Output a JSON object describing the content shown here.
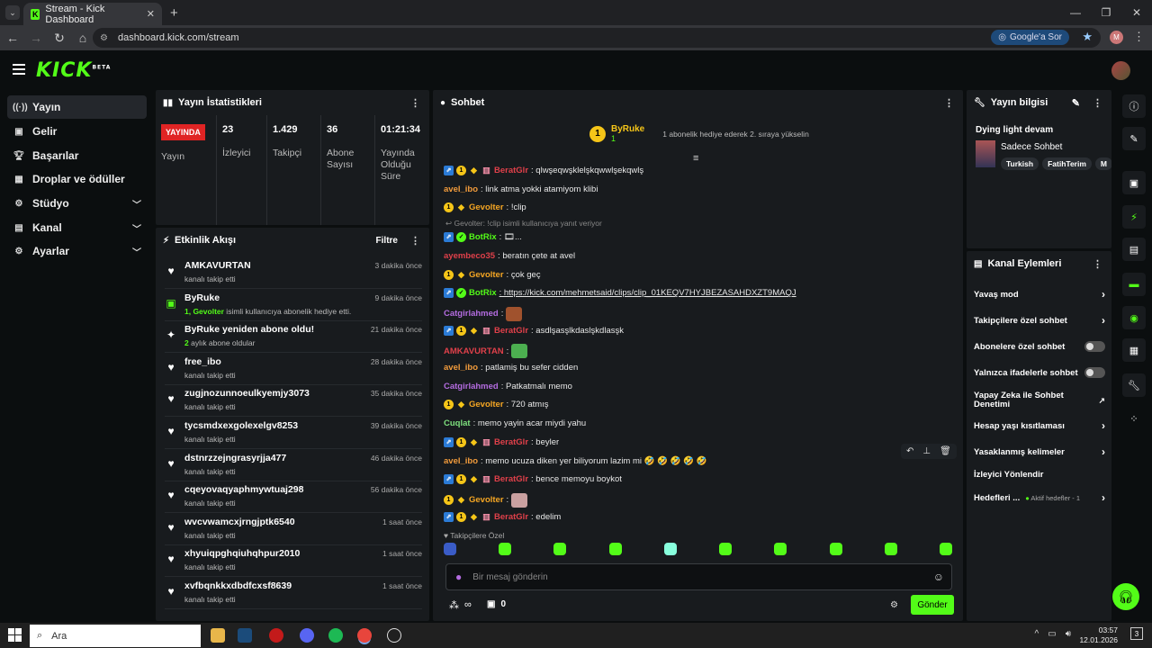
{
  "browser": {
    "tab_title": "Stream - Kick Dashboard",
    "url": "dashboard.kick.com/stream",
    "google_btn": "Google'a Sor",
    "profile_initial": "M"
  },
  "brand": {
    "logo": "KICK",
    "beta": "BETA",
    "accent": "#53fc18"
  },
  "sidebar": {
    "items": [
      {
        "label": "Yayın",
        "icon": "broadcast-icon"
      },
      {
        "label": "Gelir",
        "icon": "revenue-icon"
      },
      {
        "label": "Başarılar",
        "icon": "trophy-icon"
      },
      {
        "label": "Droplar ve ödüller",
        "icon": "gift-icon"
      },
      {
        "label": "Stüdyo",
        "icon": "studio-icon"
      },
      {
        "label": "Kanal",
        "icon": "channel-icon"
      },
      {
        "label": "Ayarlar",
        "icon": "gear-icon"
      }
    ]
  },
  "stats": {
    "title": "Yayın İstatistikleri",
    "live_badge": "YAYINDA",
    "live_label": "Yayın",
    "viewers": "23",
    "viewers_label": "İzleyici",
    "followers": "1.429",
    "followers_label": "Takipçi",
    "subs": "36",
    "subs_label": "Abone Sayısı",
    "uptime": "01:21:34",
    "uptime_label": "Yayında Olduğu Süre"
  },
  "feed": {
    "title": "Etkinlik Akışı",
    "filter": "Filtre",
    "items": [
      {
        "name": "AMKAVURTAN",
        "desc": "kanalı takip etti",
        "time": "3 dakika önce",
        "icon": "heart"
      },
      {
        "name": "ByRuke",
        "desc_hl": "1, Gevolter",
        "desc": " isimli kullanıcıya abonelik hediye etti.",
        "time": "9 dakika önce",
        "icon": "gift"
      },
      {
        "name": "ByRuke yeniden abone oldu!",
        "desc_hl": "2",
        "desc": " aylık abone oldular",
        "time": "21 dakika önce",
        "icon": "sparkle"
      },
      {
        "name": "free_ibo",
        "desc": "kanalı takip etti",
        "time": "28 dakika önce",
        "icon": "heart"
      },
      {
        "name": "zugjnozunnoeulkyemjy3073",
        "desc": "kanalı takip etti",
        "time": "35 dakika önce",
        "icon": "heart"
      },
      {
        "name": "tycsmdxexgolexelgv8253",
        "desc": "kanalı takip etti",
        "time": "39 dakika önce",
        "icon": "heart"
      },
      {
        "name": "dstnrzzejngrasyrjja477",
        "desc": "kanalı takip etti",
        "time": "46 dakika önce",
        "icon": "heart"
      },
      {
        "name": "cqeyovaqyaphmywtuaj298",
        "desc": "kanalı takip etti",
        "time": "56 dakika önce",
        "icon": "heart"
      },
      {
        "name": "wvcvwamcxjrngjptk6540",
        "desc": "kanalı takip etti",
        "time": "1 saat önce",
        "icon": "heart"
      },
      {
        "name": "xhyuiqpghqiuhqhpur2010",
        "desc": "kanalı takip etti",
        "time": "1 saat önce",
        "icon": "heart"
      },
      {
        "name": "xvfbqnkkxdbdfcxsf8639",
        "desc": "kanalı takip etti",
        "time": "1 saat önce",
        "icon": "heart"
      }
    ]
  },
  "chat": {
    "title": "Sohbet",
    "pinned_user": "ByRuke",
    "pinned_count": "1",
    "pinned_text": "1 abonelik hediye ederek 2. sıraya yükselin",
    "lines": [
      {
        "badges": [
          "vip",
          "sub",
          "og",
          "gift"
        ],
        "user": "BeratGlr",
        "color": "#e0404a",
        "text": ": qlwşeqwşklelşkqwwlşekqwlş"
      },
      {
        "badges": [],
        "user": "avel_ibo",
        "color": "#f39c3c",
        "text": ": link atma yokki atamiyom klibi"
      },
      {
        "badges": [
          "sub",
          "og"
        ],
        "user": "Gevolter",
        "color": "#f5a623",
        "text": ": !clip"
      },
      {
        "reply": "Gevolter: !clip isimli kullanıcıya yanıt veriyor"
      },
      {
        "badges": [
          "vip",
          "bot"
        ],
        "user": "BotRix",
        "color": "#53fc18",
        "text": ": 🎞..."
      },
      {
        "badges": [],
        "user": "ayembeco35",
        "color": "#e0404a",
        "text": ": beratın çete at avel"
      },
      {
        "badges": [
          "sub",
          "og"
        ],
        "user": "Gevolter",
        "color": "#f5a623",
        "text": ": çok geç"
      },
      {
        "badges": [
          "vip",
          "bot"
        ],
        "user": "BotRix",
        "color": "#53fc18",
        "text": ": https://kick.com/mehmetsaid/clips/clip_01KEQV7HYJBEZASAHDXZT9MAQJ"
      },
      {
        "badges": [],
        "user": "Catgirlahmed",
        "color": "#b46ce0",
        "text": ":",
        "emote": "#a0522d"
      },
      {
        "badges": [
          "vip",
          "sub",
          "og",
          "gift"
        ],
        "user": "BeratGlr",
        "color": "#e0404a",
        "text": ": asdlşasşlkdaslşkdlasşk"
      },
      {
        "badges": [],
        "user": "AMKAVURTAN",
        "color": "#e0404a",
        "text": ":",
        "emote": "#4caf50"
      },
      {
        "badges": [],
        "user": "avel_ibo",
        "color": "#f39c3c",
        "text": ": patlamiş bu sefer cidden"
      },
      {
        "badges": [],
        "user": "Catgirlahmed",
        "color": "#b46ce0",
        "text": ": Patkatmalı memo"
      },
      {
        "badges": [
          "sub",
          "og"
        ],
        "user": "Gevolter",
        "color": "#f5a623",
        "text": ": 720 atmış"
      },
      {
        "badges": [],
        "user": "Cuqlat",
        "color": "#7ee07e",
        "text": ": memo yayin acar miydi yahu"
      },
      {
        "badges": [
          "vip",
          "sub",
          "og",
          "gift"
        ],
        "user": "BeratGlr",
        "color": "#e0404a",
        "text": ": beyler"
      },
      {
        "badges": [],
        "user": "avel_ibo",
        "color": "#f39c3c",
        "text": ": memo ucuza diken yer biliyorum lazim mi 🤣 🤣 🤣 🤣 🤣"
      },
      {
        "badges": [
          "vip",
          "sub",
          "og",
          "gift"
        ],
        "user": "BeratGlr",
        "color": "#e0404a",
        "text": ": bence memoyu boykot"
      },
      {
        "badges": [
          "sub",
          "og"
        ],
        "user": "Gevolter",
        "color": "#f5a623",
        "text": ":",
        "emote": "#c9a0a0"
      },
      {
        "badges": [
          "vip",
          "sub",
          "og",
          "gift"
        ],
        "user": "BeratGlr",
        "color": "#e0404a",
        "text": ": edelim"
      }
    ],
    "followers_only": "Takipçilere Özel",
    "input_placeholder": "Bir mesaj gönderin",
    "points_value": "∞",
    "gift_count": "0",
    "send": "Gönder"
  },
  "stream_info": {
    "title": "Yayın bilgisi",
    "stream_title": "Dying light devam",
    "category": "Sadece Sohbet",
    "tags": [
      "Turkish",
      "FatihTerim",
      "M"
    ]
  },
  "channel_actions": {
    "title": "Kanal Eylemleri",
    "items": [
      {
        "label": "Yavaş mod",
        "type": "arrow"
      },
      {
        "label": "Takipçilere özel sohbet",
        "type": "arrow"
      },
      {
        "label": "Abonelere özel sohbet",
        "type": "toggle"
      },
      {
        "label": "Yalnızca ifadelerle sohbet",
        "type": "toggle"
      },
      {
        "label": "Yapay Zeka ile Sohbet Denetimi",
        "type": "external"
      },
      {
        "label": "Hesap yaşı kısıtlaması",
        "type": "arrow"
      },
      {
        "label": "Yasaklanmış kelimeler",
        "type": "arrow"
      },
      {
        "label": "İzleyici Yönlendir",
        "type": "none"
      },
      {
        "label": "Hedefleri ...",
        "type": "arrow",
        "sub": "Aktif hedefler - 1"
      }
    ]
  },
  "taskbar": {
    "search": "Ara",
    "time": "03:57",
    "date": "12.01.2026",
    "notif": "3"
  }
}
